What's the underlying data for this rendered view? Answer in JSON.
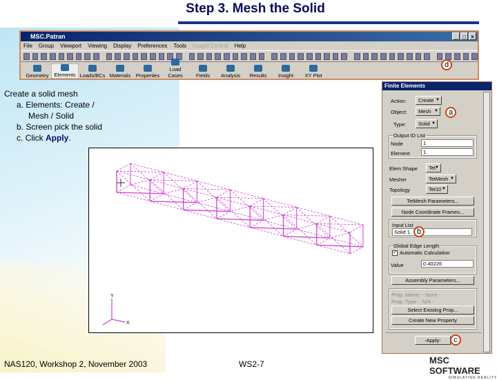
{
  "slide": {
    "title": "Step 3.  Mesh the Solid",
    "footer_left": "NAS120, Workshop 2, November 2003",
    "footer_center": "WS2-7",
    "logo": "MSC SOFTWARE",
    "logo_tagline": "SIMULATING REALITY"
  },
  "instructions": {
    "intro": "Create a solid mesh",
    "steps": [
      "a.  Elements: Create /",
      "Mesh / Solid",
      "b.  Screen pick the solid",
      "c.  Click "
    ],
    "apply_word": "Apply",
    "period": "."
  },
  "window": {
    "title": "MSC.Patran",
    "controls": [
      "_",
      "□",
      "×"
    ],
    "menu": [
      "File",
      "Group",
      "Viewport",
      "Viewing",
      "Display",
      "Preferences",
      "Tools",
      "Insight Control",
      "Help"
    ],
    "apps": [
      "Geometry",
      "Elements",
      "Loads/BCs",
      "Materials",
      "Properties",
      "Load Cases",
      "Fields",
      "Analysis",
      "Results",
      "Insight",
      "XY Plot"
    ],
    "selected_app": "Elements"
  },
  "panel": {
    "title": "Finite Elements",
    "action_label": "Action:",
    "action": "Create",
    "object_label": "Object:",
    "object": "Mesh",
    "type_label": "Type:",
    "type": "Solid",
    "output_group": "Output ID List",
    "node_label": "Node",
    "node": "1",
    "element_label": "Element",
    "element": "1",
    "shape_label": "Elem Shape",
    "shape": "Tet",
    "mesher_label": "Mesher",
    "mesher": "TetMesh",
    "topology_label": "Topology",
    "topology": "Tet10",
    "tet_params": "TetMesh Parameters...",
    "node_frames": "Node Coordinate Frames...",
    "input_group": "Input List",
    "input": "Solid 1",
    "edge_group": "Global Edge Length",
    "auto_calc": "Automatic Calculation",
    "auto_checked": true,
    "value_label": "Value",
    "value": "0.40226",
    "assembly": "Assembly Parameters...",
    "prop_name": "Prop. Name:   - None -",
    "prop_type": "Prop. Type:   - N/A -",
    "select_prop": "Select Existing Prop...",
    "create_prop": "Create New Property",
    "apply": "-Apply-"
  },
  "viewport": {
    "axis_x": "X",
    "axis_y": "Y",
    "mesh_color": "#d040d0"
  },
  "callouts": {
    "a": "a",
    "b": "b",
    "c": "c",
    "d": "d"
  }
}
